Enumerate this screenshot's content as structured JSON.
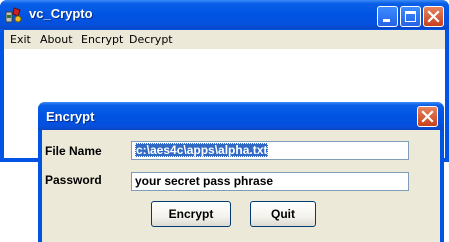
{
  "main_window": {
    "title": "vc_Crypto",
    "menu": [
      "Exit",
      "About",
      "Encrypt",
      "Decrypt"
    ]
  },
  "dialog": {
    "title": "Encrypt",
    "file_name_label": "File Name",
    "file_name_value": "c:\\aes4c\\apps\\alpha.txt",
    "password_label": "Password",
    "password_value": "your secret pass phrase",
    "encrypt_button": "Encrypt",
    "quit_button": "Quit"
  },
  "icons": {
    "app": "app-icon",
    "minimize": "minimize-icon",
    "maximize": "maximize-icon",
    "close": "close-icon"
  },
  "colors": {
    "titlebar": "#0054e3",
    "close_button": "#c8401c",
    "dialog_face": "#ece9d8",
    "selection": "#316ac5"
  }
}
